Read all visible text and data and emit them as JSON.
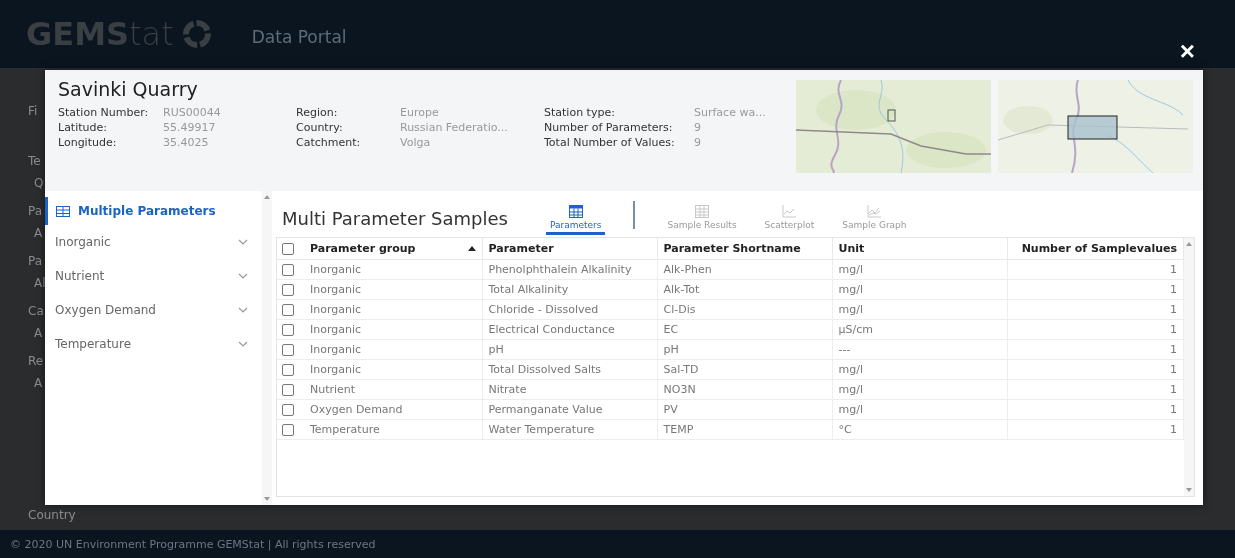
{
  "header": {
    "logo": "**GEMS**tat",
    "subtitle": "Data Portal",
    "close": "×"
  },
  "background": {
    "filters": [
      {
        "label": "Fi"
      },
      {
        "label": "Te",
        "value": "Q"
      },
      {
        "label": "Pa",
        "value": "A"
      },
      {
        "label": "Pa",
        "value": "Al"
      },
      {
        "label": "Ca",
        "value": "A"
      },
      {
        "label": "Re",
        "value": "A"
      }
    ],
    "bottom_label": "Country",
    "footer": "© 2020 UN Environment Programme GEMStat | All rights reserved"
  },
  "station": {
    "title": "Savinki Quarry",
    "info_columns": [
      [
        {
          "label": "Station Number:",
          "value": "RUS00044"
        },
        {
          "label": "Latitude:",
          "value": "55.49917"
        },
        {
          "label": "Longitude:",
          "value": "35.4025"
        }
      ],
      [
        {
          "label": "Region:",
          "value": "Europe"
        },
        {
          "label": "Country:",
          "value": "Russian Federatio..."
        },
        {
          "label": "Catchment:",
          "value": "Volga"
        }
      ],
      [
        {
          "label": "Station type:",
          "value": "Surface wa..."
        },
        {
          "label": "Number of Parameters:",
          "value": "9"
        },
        {
          "label": "Total Number of Values:",
          "value": "9"
        }
      ]
    ]
  },
  "sidebar": {
    "items": [
      {
        "label": "Multiple Parameters",
        "selected": true,
        "expanded": false
      },
      {
        "label": "Inorganic",
        "selected": false,
        "expanded": false
      },
      {
        "label": "Nutrient",
        "selected": false,
        "expanded": false
      },
      {
        "label": "Oxygen Demand",
        "selected": false,
        "expanded": false
      },
      {
        "label": "Temperature",
        "selected": false,
        "expanded": false
      }
    ]
  },
  "content": {
    "title": "Multi Parameter Samples",
    "tabs": [
      {
        "label": "Parameters",
        "selected": true,
        "disabled": false
      },
      {
        "label": "Sample Results",
        "selected": false,
        "disabled": true
      },
      {
        "label": "Scatterplot",
        "selected": false,
        "disabled": true
      },
      {
        "label": "Sample Graph",
        "selected": false,
        "disabled": true
      }
    ],
    "table": {
      "select_all_checked": false,
      "columns": [
        {
          "label": "Parameter group",
          "sorted": true
        },
        {
          "label": "Parameter",
          "sorted": false
        },
        {
          "label": "Parameter Shortname",
          "sorted": false
        },
        {
          "label": "Unit",
          "sorted": false
        },
        {
          "label": "Number of Samplevalues",
          "sorted": false
        }
      ],
      "rows": [
        {
          "checked": false,
          "cells": [
            "Inorganic",
            "Phenolphthalein Alkalinity",
            "Alk-Phen",
            "mg/l",
            "1"
          ]
        },
        {
          "checked": false,
          "cells": [
            "Inorganic",
            "Total Alkalinity",
            "Alk-Tot",
            "mg/l",
            "1"
          ]
        },
        {
          "checked": false,
          "cells": [
            "Inorganic",
            "Chloride - Dissolved",
            "Cl-Dis",
            "mg/l",
            "1"
          ]
        },
        {
          "checked": false,
          "cells": [
            "Inorganic",
            "Electrical Conductance",
            "EC",
            "µS/cm",
            "1"
          ]
        },
        {
          "checked": false,
          "cells": [
            "Inorganic",
            "pH",
            "pH",
            "---",
            "1"
          ]
        },
        {
          "checked": false,
          "cells": [
            "Inorganic",
            "Total Dissolved Salts",
            "Sal-TD",
            "mg/l",
            "1"
          ]
        },
        {
          "checked": false,
          "cells": [
            "Nutrient",
            "Nitrate",
            "NO3N",
            "mg/l",
            "1"
          ]
        },
        {
          "checked": false,
          "cells": [
            "Oxygen Demand",
            "Permanganate Value",
            "PV",
            "mg/l",
            "1"
          ]
        },
        {
          "checked": false,
          "cells": [
            "Temperature",
            "Water Temperature",
            "TEMP",
            "°C",
            "1"
          ]
        }
      ]
    }
  }
}
